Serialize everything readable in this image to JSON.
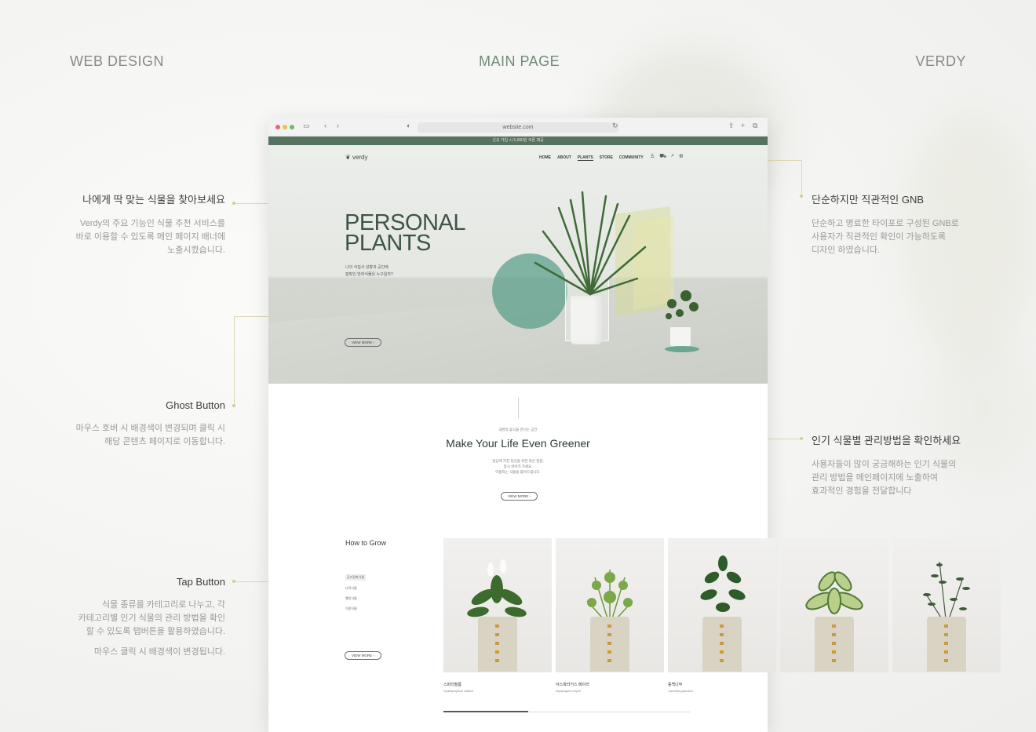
{
  "header": {
    "left": "WEB DESIGN",
    "center": "MAIN PAGE",
    "right": "VERDY"
  },
  "annotations": {
    "banner": {
      "title": "나에게 딱 맞는 식물을 찾아보세요",
      "lines": [
        "Verdy의 주요 기능인 식물 추천 서비스를",
        "바로 이용할 수 있도록 메인 페이지 배너에",
        "노출시켰습니다."
      ]
    },
    "ghost": {
      "title": "Ghost Button",
      "lines": [
        "마우스 호버 시 배경색이 변경되며 클릭 시",
        "해당 콘텐츠 페이지로 이동합니다."
      ]
    },
    "tap": {
      "title": "Tap Button",
      "lines": [
        "식물 종류를 카테고리로 나누고, 각",
        "카테고리별 인기 식물의 관리 방법을 확인",
        "할 수 있도록 탭버튼을 활용하였습니다."
      ],
      "extra": "마우스 클릭 시 배경색이 변경됩니다."
    },
    "gnb": {
      "title": "단순하지만 직관적인 GNB",
      "lines": [
        "단순하고 명료한 타이포로 구성된 GNB로",
        "사용자가 직관적인 확인이 가능하도록",
        "디자인 하였습니다."
      ]
    },
    "care": {
      "title": "인기 식물별 관리방법을 확인하세요",
      "lines": [
        "사용자들이 많이 궁금해하는 인기 식물의",
        "관리 방법을 메인페이지에 노출하여",
        "효과적인 경험을 전달합니다"
      ]
    }
  },
  "browser": {
    "url": "website.com",
    "promo": "신규 가입 시 5,000원 쿠폰 제공",
    "logo": "verdy",
    "nav": [
      "HOME",
      "ABOUT",
      "PLANTS",
      "STORE",
      "COMMUNITY"
    ],
    "nav_active": "PLANTS",
    "icons": [
      "user-icon",
      "cart-icon",
      "search-icon",
      "globe-icon"
    ]
  },
  "hero": {
    "title_line1": "PERSONAL",
    "title_line2": "PLANTS",
    "sub_line1": "나의 식집사 성향과 공간에",
    "sub_line2": "잘맞인 반려식물은 누구일까?",
    "button": "VIEW MORE"
  },
  "section2": {
    "eyebrow": "내면의 휴식을 만나는 공간",
    "title": "Make Your Life Even Greener",
    "desc1": "일상에 지친 당신을 위한 작은 정원,",
    "desc2": "잠시 쉬어가 가세요.",
    "desc3": "어울리는 식물을 찾아드립니다.",
    "button": "VIEW MORE"
  },
  "how_to_grow": {
    "title": "How to Grow",
    "tabs": [
      "공기정화식물",
      "다육식물",
      "행잉식물",
      "식용식물"
    ],
    "active_tab": "공기정화식물",
    "button": "VIEW MORE",
    "cards": [
      {
        "name": "스파티필름",
        "sci": "Spathiphyllum wallisii"
      },
      {
        "name": "아스파라거스 메이리",
        "sci": "Asparagus meyeri"
      },
      {
        "name": "동백나무",
        "sci": "Camellia japonica"
      },
      {
        "name": "",
        "sci": ""
      },
      {
        "name": "",
        "sci": ""
      }
    ]
  }
}
